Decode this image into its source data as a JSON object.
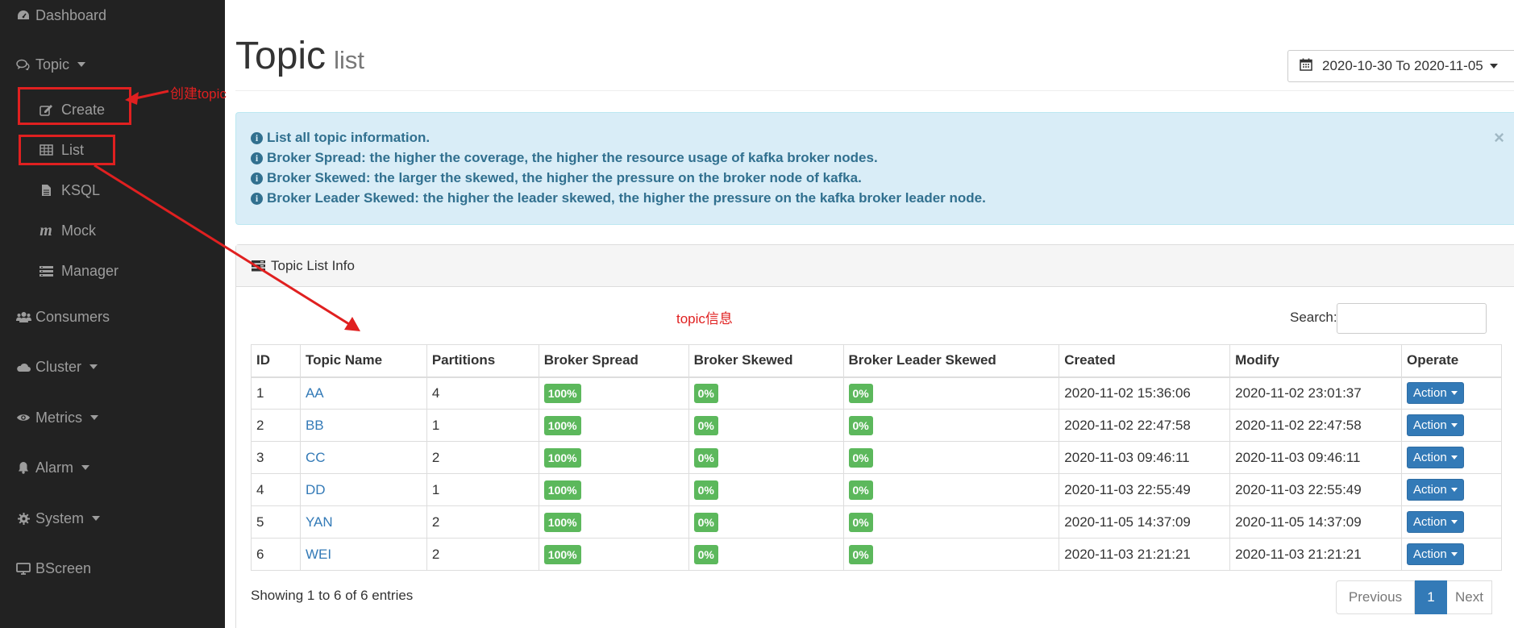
{
  "sidebar": {
    "dashboard": "Dashboard",
    "topic": "Topic",
    "topic_items": {
      "create": "Create",
      "list": "List",
      "ksql": "KSQL",
      "mock": "Mock",
      "manager": "Manager"
    },
    "consumers": "Consumers",
    "cluster": "Cluster",
    "metrics": "Metrics",
    "alarm": "Alarm",
    "system": "System",
    "bscreen": "BScreen"
  },
  "annotations": {
    "create_topic": "创建topic",
    "topic_info": "topic信息",
    "color": "#e02020"
  },
  "header": {
    "title": "Topic",
    "subtitle": "list",
    "daterange": "2020-10-30 To 2020-11-05"
  },
  "alert": {
    "lines": [
      "List all topic information.",
      "Broker Spread: the higher the coverage, the higher the resource usage of kafka broker nodes.",
      "Broker Skewed: the larger the skewed, the higher the pressure on the broker node of kafka.",
      "Broker Leader Skewed: the higher the leader skewed, the higher the pressure on the kafka broker leader node."
    ],
    "close": "×"
  },
  "panel": {
    "title": "Topic List Info",
    "search_label": "Search:",
    "columns": [
      "ID",
      "Topic Name",
      "Partitions",
      "Broker Spread",
      "Broker Skewed",
      "Broker Leader Skewed",
      "Created",
      "Modify",
      "Operate"
    ],
    "rows": [
      {
        "id": "1",
        "name": "AA",
        "partitions": "4",
        "spread": "100%",
        "skewed": "0%",
        "leader_skewed": "0%",
        "created": "2020-11-02 15:36:06",
        "modify": "2020-11-02 23:01:37",
        "operate": "Action"
      },
      {
        "id": "2",
        "name": "BB",
        "partitions": "1",
        "spread": "100%",
        "skewed": "0%",
        "leader_skewed": "0%",
        "created": "2020-11-02 22:47:58",
        "modify": "2020-11-02 22:47:58",
        "operate": "Action"
      },
      {
        "id": "3",
        "name": "CC",
        "partitions": "2",
        "spread": "100%",
        "skewed": "0%",
        "leader_skewed": "0%",
        "created": "2020-11-03 09:46:11",
        "modify": "2020-11-03 09:46:11",
        "operate": "Action"
      },
      {
        "id": "4",
        "name": "DD",
        "partitions": "1",
        "spread": "100%",
        "skewed": "0%",
        "leader_skewed": "0%",
        "created": "2020-11-03 22:55:49",
        "modify": "2020-11-03 22:55:49",
        "operate": "Action"
      },
      {
        "id": "5",
        "name": "YAN",
        "partitions": "2",
        "spread": "100%",
        "skewed": "0%",
        "leader_skewed": "0%",
        "created": "2020-11-05 14:37:09",
        "modify": "2020-11-05 14:37:09",
        "operate": "Action"
      },
      {
        "id": "6",
        "name": "WEI",
        "partitions": "2",
        "spread": "100%",
        "skewed": "0%",
        "leader_skewed": "0%",
        "created": "2020-11-03 21:21:21",
        "modify": "2020-11-03 21:21:21",
        "operate": "Action"
      }
    ],
    "showing": "Showing 1 to 6 of 6 entries",
    "pagination": {
      "previous": "Previous",
      "current": "1",
      "next": "Next"
    }
  },
  "icons": [
    "dashboard-icon",
    "comments-icon",
    "edit-icon",
    "table-icon",
    "file-icon",
    "mock-icon",
    "list-icon",
    "users-icon",
    "cloud-icon",
    "eye-icon",
    "bell-icon",
    "gear-icon",
    "desktop-icon",
    "calendar-icon",
    "info-icon",
    "server-icon"
  ]
}
